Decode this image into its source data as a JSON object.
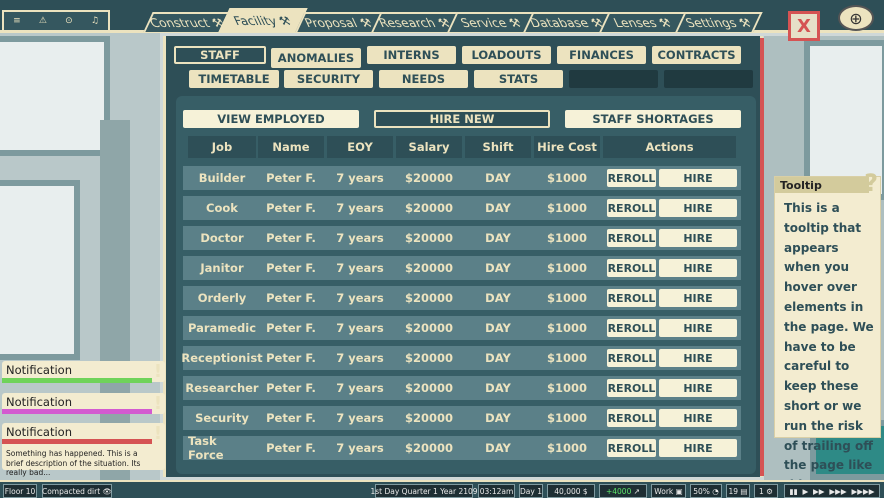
{
  "system_icons": [
    "≡",
    "⚠",
    "⊙",
    "♫"
  ],
  "tabs": [
    {
      "label": "Construct",
      "icon": "⚒"
    },
    {
      "label": "Facility",
      "icon": "⚒",
      "active": true
    },
    {
      "label": "Proposal",
      "icon": "⚒"
    },
    {
      "label": "Research",
      "icon": "⚒"
    },
    {
      "label": "Service",
      "icon": "⚒"
    },
    {
      "label": "Database",
      "icon": "⚒"
    },
    {
      "label": "Lenses",
      "icon": "⚒"
    },
    {
      "label": "Settings",
      "icon": "⚒"
    }
  ],
  "close_label": "X",
  "globe_icon": "⊕",
  "subtabs": {
    "staff": "STAFF",
    "anomalies": "ANOMALIES",
    "interns": "INTERNS",
    "loadouts": "LOADOUTS",
    "finances": "FINANCES",
    "contracts": "CONTRACTS",
    "timetable": "TIMETABLE",
    "security": "SECURITY",
    "needs": "NEEDS",
    "stats": "STATS"
  },
  "actions": {
    "view_employed": "VIEW EMPLOYED",
    "hire_new": "HIRE NEW",
    "staff_shortages": "STAFF SHORTAGES"
  },
  "table": {
    "headers": {
      "job": "Job",
      "name": "Name",
      "eoy": "EOY",
      "salary": "Salary",
      "shift": "Shift",
      "hire_cost": "Hire Cost",
      "actions": "Actions"
    },
    "reroll_label": "REROLL",
    "hire_label": "HIRE",
    "rows": [
      {
        "job": "Builder",
        "name": "Peter F.",
        "eoy": "7 years",
        "salary": "$20000",
        "shift": "DAY",
        "hire_cost": "$1000"
      },
      {
        "job": "Cook",
        "name": "Peter F.",
        "eoy": "7 years",
        "salary": "$20000",
        "shift": "DAY",
        "hire_cost": "$1000"
      },
      {
        "job": "Doctor",
        "name": "Peter F.",
        "eoy": "7 years",
        "salary": "$20000",
        "shift": "DAY",
        "hire_cost": "$1000"
      },
      {
        "job": "Janitor",
        "name": "Peter F.",
        "eoy": "7 years",
        "salary": "$20000",
        "shift": "DAY",
        "hire_cost": "$1000"
      },
      {
        "job": "Orderly",
        "name": "Peter F.",
        "eoy": "7 years",
        "salary": "$20000",
        "shift": "DAY",
        "hire_cost": "$1000"
      },
      {
        "job": "Paramedic",
        "name": "Peter F.",
        "eoy": "7 years",
        "salary": "$20000",
        "shift": "DAY",
        "hire_cost": "$1000"
      },
      {
        "job": "Receptionist",
        "name": "Peter F.",
        "eoy": "7 years",
        "salary": "$20000",
        "shift": "DAY",
        "hire_cost": "$1000"
      },
      {
        "job": "Researcher",
        "name": "Peter F.",
        "eoy": "7 years",
        "salary": "$20000",
        "shift": "DAY",
        "hire_cost": "$1000"
      },
      {
        "job": "Security",
        "name": "Peter F.",
        "eoy": "7 years",
        "salary": "$20000",
        "shift": "DAY",
        "hire_cost": "$1000"
      },
      {
        "job": "Task Force",
        "name": "Peter F.",
        "eoy": "7 years",
        "salary": "$20000",
        "shift": "DAY",
        "hire_cost": "$1000"
      }
    ]
  },
  "tooltip": {
    "title": "Tooltip",
    "icon": "?",
    "body": "This is a tooltip that appears when you hover over elements in the page. We have to be careful to keep these short or we run the risk of trailing off the page like this..."
  },
  "notifications": [
    {
      "title": "Notification",
      "color": "#6fd35a",
      "icon": "!"
    },
    {
      "title": "Notification",
      "color": "#d35ad0",
      "icon": "!"
    },
    {
      "title": "Notification",
      "color": "#d55353",
      "icon": "!",
      "body": "Something has happened.  This is a brief description of the situation. Its really bad..."
    }
  ],
  "status": {
    "floor": "Floor 10",
    "terrain": "Compacted dirt",
    "date": "1st Day Quarter 1 Year 2109",
    "time": "03:12am",
    "day": "Day 1",
    "money": "40,000",
    "currency_icon": "$",
    "income": "+4000",
    "mode": "Work",
    "percent": "50%",
    "staff_count": "19",
    "alerts": "1",
    "speeds": [
      "▮▮",
      "▶",
      "▶▶",
      "▶▶▶",
      "▶▶▶▶"
    ]
  },
  "colors": {
    "primary": "#2e4f57",
    "cream": "#ece3bf",
    "alert_red": "#d55353"
  }
}
